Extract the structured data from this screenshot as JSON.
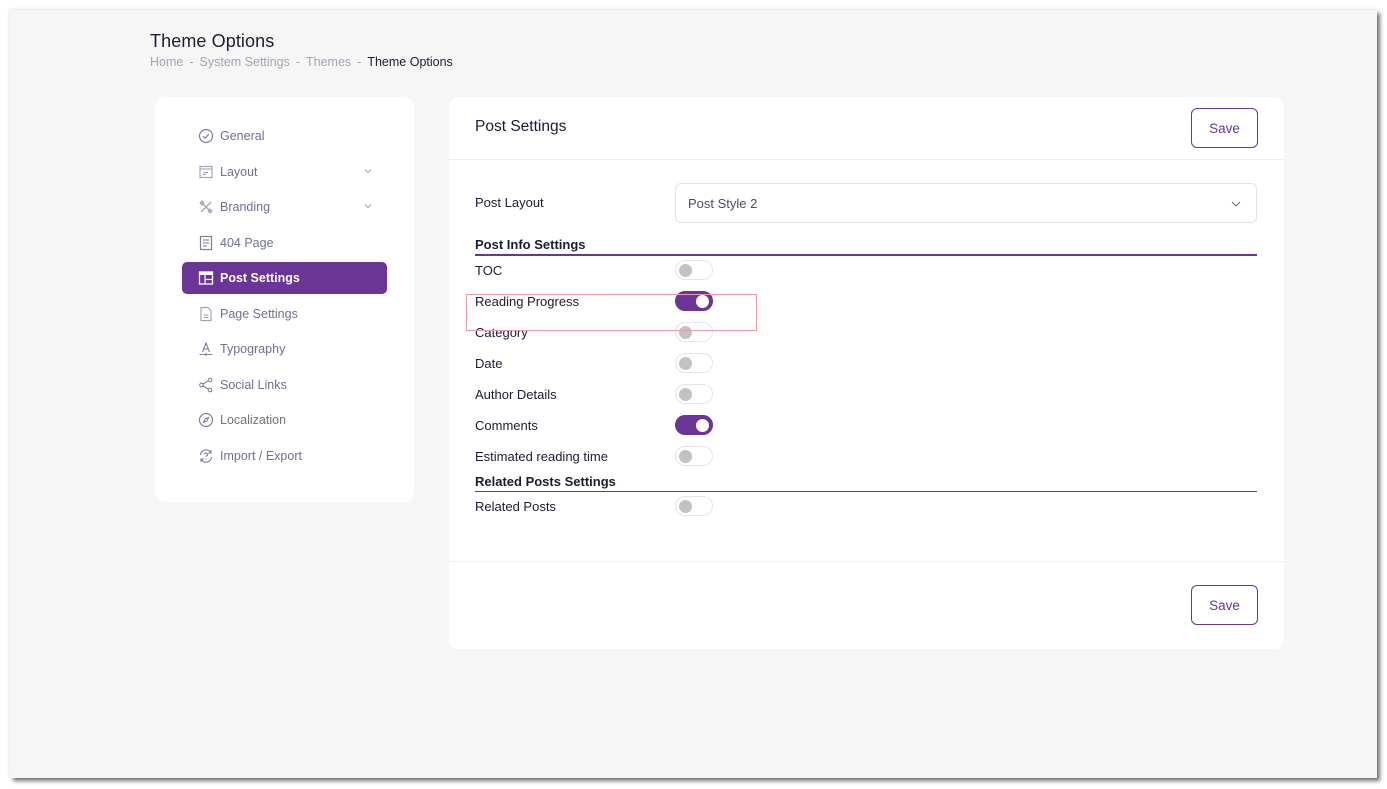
{
  "page": {
    "title": "Theme Options",
    "breadcrumb": [
      "Home",
      "System Settings",
      "Themes",
      "Theme Options"
    ],
    "breadcrumb_separator": "-"
  },
  "sidebar": {
    "items": [
      {
        "label": "General",
        "icon": "check-circle-icon",
        "has_submenu": false,
        "active": false
      },
      {
        "label": "Layout",
        "icon": "layout-icon",
        "has_submenu": true,
        "active": false
      },
      {
        "label": "Branding",
        "icon": "tools-icon",
        "has_submenu": true,
        "active": false
      },
      {
        "label": "404 Page",
        "icon": "document-lines-icon",
        "has_submenu": false,
        "active": false
      },
      {
        "label": "Post Settings",
        "icon": "post-layout-icon",
        "has_submenu": false,
        "active": true
      },
      {
        "label": "Page Settings",
        "icon": "page-file-icon",
        "has_submenu": false,
        "active": false
      },
      {
        "label": "Typography",
        "icon": "typography-icon",
        "has_submenu": false,
        "active": false
      },
      {
        "label": "Social Links",
        "icon": "share-icon",
        "has_submenu": false,
        "active": false
      },
      {
        "label": "Localization",
        "icon": "compass-icon",
        "has_submenu": false,
        "active": false
      },
      {
        "label": "Import / Export",
        "icon": "sync-question-icon",
        "has_submenu": false,
        "active": false
      }
    ]
  },
  "main": {
    "title": "Post Settings",
    "save_label": "Save",
    "post_layout": {
      "label": "Post Layout",
      "value": "Post Style 2"
    },
    "sections": [
      {
        "title": "Post Info Settings",
        "toggles": [
          {
            "label": "TOC",
            "on": false
          },
          {
            "label": "Reading Progress",
            "on": true,
            "highlighted": true
          },
          {
            "label": "Category",
            "on": false
          },
          {
            "label": "Date",
            "on": false
          },
          {
            "label": "Author Details",
            "on": false
          },
          {
            "label": "Comments",
            "on": true
          },
          {
            "label": "Estimated reading time",
            "on": false
          }
        ]
      },
      {
        "title": "Related Posts Settings",
        "toggles": [
          {
            "label": "Related Posts",
            "on": false
          }
        ]
      }
    ]
  },
  "colors": {
    "accent": "#6a3597",
    "toggle_off_knob": "#c2c2c6",
    "highlight_border": "#ef9aa6",
    "background": "#f6f6f6"
  }
}
